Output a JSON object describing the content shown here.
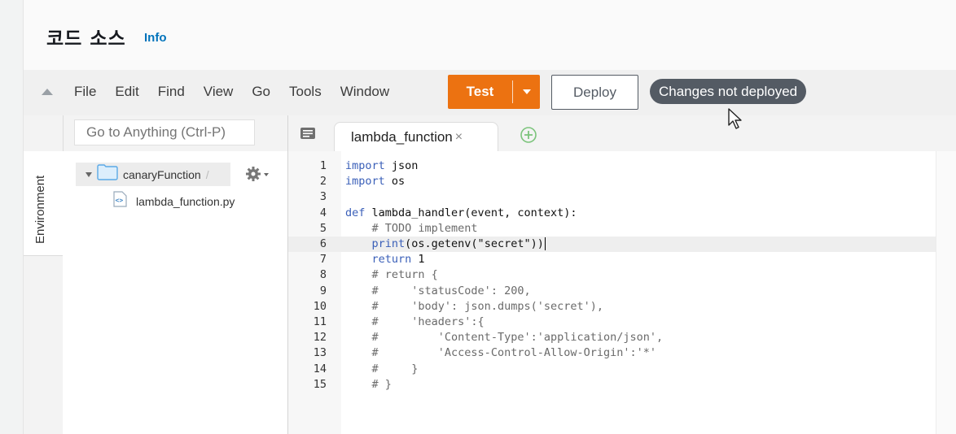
{
  "page": {
    "title": "코드 소스",
    "info_link": "Info"
  },
  "menu": [
    "File",
    "Edit",
    "Find",
    "View",
    "Go",
    "Tools",
    "Window"
  ],
  "buttons": {
    "test": "Test",
    "deploy": "Deploy"
  },
  "status": "Changes not deployed",
  "search": {
    "placeholder": "Go to Anything (Ctrl-P)"
  },
  "sidebar": {
    "environment_tab": "Environment",
    "root_folder": "canaryFunction",
    "root_suffix": "/",
    "files": [
      "lambda_function.py"
    ]
  },
  "editor": {
    "tab_title": "lambda_function",
    "tab_close": "×",
    "active_line": 6,
    "lines": [
      "import json",
      "import os",
      "",
      "def lambda_handler(event, context):",
      "    # TODO implement",
      "    print(os.getenv(\"secret\"))",
      "    return 1",
      "    # return {",
      "    #     'statusCode': 200,",
      "    #     'body': json.dumps('secret'),",
      "    #     'headers':{",
      "    #         'Content-Type':'application/json',",
      "    #         'Access-Control-Allow-Origin':'*'",
      "    #     }",
      "    # }"
    ]
  },
  "colors": {
    "accent": "#ec7211",
    "status_pill": "#545b64",
    "link": "#0073bb",
    "keyword": "#3a5fb8"
  }
}
